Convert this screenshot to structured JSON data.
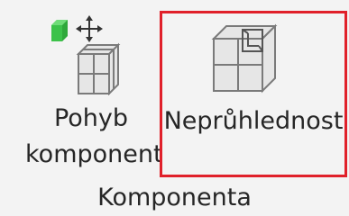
{
  "ribbon_group": {
    "label": "Komponenta",
    "buttons": [
      {
        "label_line1": "Pohyb",
        "label_line2": "komponent",
        "icon": "move-component-icon"
      },
      {
        "label_line1": "Neprůhlednost",
        "icon": "opacity-icon",
        "highlighted": true,
        "highlight_color": "#e0202a"
      }
    ]
  },
  "colors": {
    "background": "#f3f3f3",
    "text": "#262626",
    "green_block": "#3cc24a",
    "cube_fill": "#e6e6e6",
    "cube_stroke": "#7a7a7a"
  }
}
